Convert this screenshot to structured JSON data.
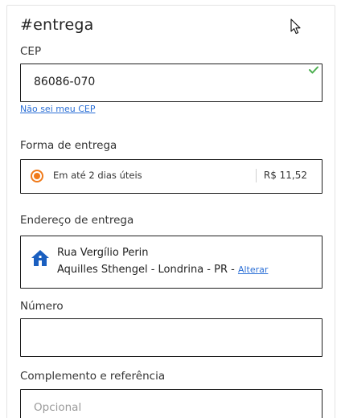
{
  "title": "#entrega",
  "cep": {
    "label": "CEP",
    "value": "86086-070",
    "help_link": "Não sei meu CEP"
  },
  "shipping": {
    "label": "Forma de entrega",
    "option": "Em até 2 dias úteis",
    "price": "R$ 11,52",
    "selected": true
  },
  "address": {
    "label": "Endereço de entrega",
    "street": "Rua Vergílio Perin",
    "district": "Aquilles Sthengel - Londrina - PR - ",
    "change_link": "Alterar"
  },
  "number": {
    "label": "Número",
    "value": ""
  },
  "complement": {
    "label": "Complemento e referência",
    "placeholder": "Opcional"
  },
  "colors": {
    "accent": "#f07a1a",
    "link": "#2b6fd6",
    "valid": "#4caf50",
    "home_icon": "#1a5fc0"
  }
}
